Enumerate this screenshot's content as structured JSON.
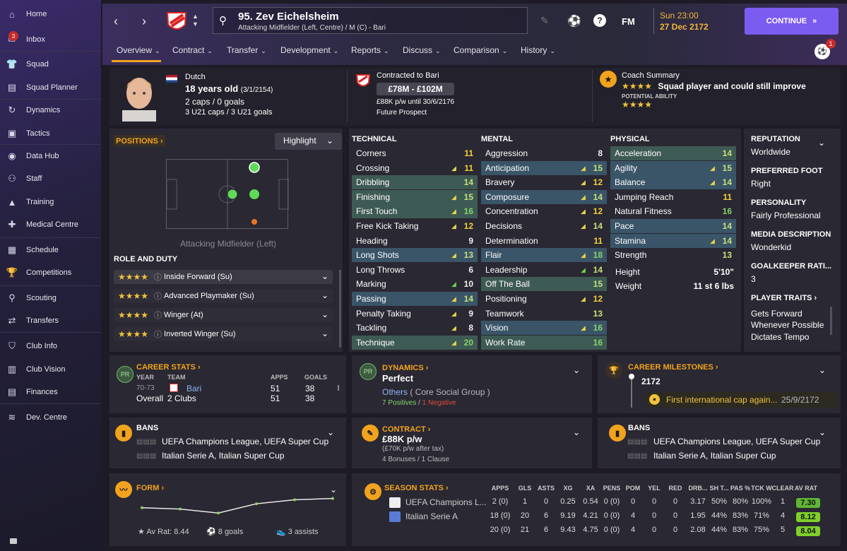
{
  "sidebar": {
    "items": [
      {
        "label": "Home",
        "icon": "home-icon"
      },
      {
        "label": "Inbox",
        "icon": "inbox-icon",
        "badge": "3"
      },
      {
        "label": "Squad",
        "icon": "squad-icon"
      },
      {
        "label": "Squad Planner",
        "icon": "planner-icon"
      },
      {
        "label": "Dynamics",
        "icon": "dynamics-icon"
      },
      {
        "label": "Tactics",
        "icon": "tactics-icon"
      },
      {
        "label": "Data Hub",
        "icon": "data-hub-icon"
      },
      {
        "label": "Staff",
        "icon": "staff-icon"
      },
      {
        "label": "Training",
        "icon": "training-icon"
      },
      {
        "label": "Medical Centre",
        "icon": "medical-icon"
      },
      {
        "label": "Schedule",
        "icon": "schedule-icon"
      },
      {
        "label": "Competitions",
        "icon": "trophy-icon"
      },
      {
        "label": "Scouting",
        "icon": "scouting-icon"
      },
      {
        "label": "Transfers",
        "icon": "transfers-icon"
      },
      {
        "label": "Club Info",
        "icon": "shield-icon"
      },
      {
        "label": "Club Vision",
        "icon": "vision-icon"
      },
      {
        "label": "Finances",
        "icon": "finances-icon"
      },
      {
        "label": "Dev. Centre",
        "icon": "dev-icon"
      }
    ]
  },
  "header": {
    "title": "95. Zev Eichelsheim",
    "subtitle": "Attacking Midfielder (Left, Centre) / M (C) - Bari",
    "date_line1": "Sun 23:00",
    "date_line2": "27 Dec 2172",
    "fm_label": "FM",
    "continue_label": "CONTINUE",
    "notif_count": "1"
  },
  "tabs": [
    "Overview",
    "Contract",
    "Transfer",
    "Development",
    "Reports",
    "Discuss",
    "Comparison",
    "History"
  ],
  "bio": {
    "nationality": "Dutch",
    "age": "18 years old",
    "dob": "(3/1/2154)",
    "caps": "2 caps / 0 goals",
    "u21": "3 U21 caps / 3 U21 goals"
  },
  "contract_box": {
    "label": "Contracted to Bari",
    "value_range": "£78M - £102M",
    "wage": "£88K p/w until 30/6/2176",
    "status": "Future Prospect"
  },
  "coach": {
    "label": "Coach Summary",
    "stars": "★★★★",
    "summary": "Squad player and could still improve",
    "potential_label": "POTENTIAL ABILITY",
    "potential_stars": "★★★★"
  },
  "positions": {
    "title": "POSITIONS",
    "highlight": "Highlight",
    "caption": "Attacking Midfielder (Left)"
  },
  "roles": {
    "title": "ROLE AND DUTY",
    "items": [
      {
        "stars": "★★★★",
        "name": "Inside Forward (Su)"
      },
      {
        "stars": "★★★★",
        "name": "Advanced Playmaker (Su)"
      },
      {
        "stars": "★★★★",
        "name": "Winger (At)"
      },
      {
        "stars": "★★★★",
        "name": "Inverted Winger (Su)"
      }
    ]
  },
  "technical": {
    "title": "TECHNICAL",
    "rows": [
      [
        "Corners",
        "11"
      ],
      [
        "Crossing",
        "11"
      ],
      [
        "Dribbling",
        "14"
      ],
      [
        "Finishing",
        "15"
      ],
      [
        "First Touch",
        "16"
      ],
      [
        "Free Kick Taking",
        "12"
      ],
      [
        "Heading",
        "9"
      ],
      [
        "Long Shots",
        "13"
      ],
      [
        "Long Throws",
        "6"
      ],
      [
        "Marking",
        "10"
      ],
      [
        "Passing",
        "14"
      ],
      [
        "Penalty Taking",
        "9"
      ],
      [
        "Tackling",
        "8"
      ],
      [
        "Technique",
        "20"
      ]
    ]
  },
  "mental": {
    "title": "MENTAL",
    "rows": [
      [
        "Aggression",
        "8"
      ],
      [
        "Anticipation",
        "15"
      ],
      [
        "Bravery",
        "12"
      ],
      [
        "Composure",
        "14"
      ],
      [
        "Concentration",
        "12"
      ],
      [
        "Decisions",
        "14"
      ],
      [
        "Determination",
        "11"
      ],
      [
        "Flair",
        "18"
      ],
      [
        "Leadership",
        "14"
      ],
      [
        "Off The Ball",
        "15"
      ],
      [
        "Positioning",
        "12"
      ],
      [
        "Teamwork",
        "13"
      ],
      [
        "Vision",
        "16"
      ],
      [
        "Work Rate",
        "16"
      ]
    ]
  },
  "physical": {
    "title": "PHYSICAL",
    "rows": [
      [
        "Acceleration",
        "14"
      ],
      [
        "Agility",
        "15"
      ],
      [
        "Balance",
        "14"
      ],
      [
        "Jumping Reach",
        "11"
      ],
      [
        "Natural Fitness",
        "16"
      ],
      [
        "Pace",
        "14"
      ],
      [
        "Stamina",
        "14"
      ],
      [
        "Strength",
        "13"
      ]
    ],
    "height_label": "Height",
    "height": "5'10\"",
    "weight_label": "Weight",
    "weight": "11 st 6 lbs"
  },
  "info": {
    "rep_label": "REPUTATION",
    "rep": "Worldwide",
    "foot_label": "PREFERRED FOOT",
    "foot": "Right",
    "pers_label": "PERSONALITY",
    "pers": "Fairly Professional",
    "media_label": "MEDIA DESCRIPTION",
    "media": "Wonderkid",
    "gk_label": "GOALKEEPER RATI...",
    "gk": "3",
    "traits_label": "PLAYER TRAITS",
    "traits": [
      "Gets Forward Whenever Possible",
      "Dictates Tempo"
    ]
  },
  "career": {
    "title": "CAREER STATS",
    "badge": "PR",
    "col_year": "YEAR",
    "col_team": "TEAM",
    "col_apps": "APPS",
    "col_goals": "GOALS",
    "row1": {
      "year": "70-73",
      "team": "Bari",
      "apps": "51",
      "goals": "38"
    },
    "row2": {
      "year": "Overall",
      "team": "2 Clubs",
      "apps": "51",
      "goals": "38"
    }
  },
  "dynamics": {
    "title": "DYNAMICS",
    "badge": "PR",
    "status": "Perfect",
    "group": "Others",
    "group_suffix": "( Core Social Group )",
    "positives": "7 Positives",
    "negatives": "1 Negative",
    "sep": "/"
  },
  "milestones": {
    "title": "CAREER MILESTONES",
    "year": "2172",
    "text": "First international cap again...",
    "date": "25/9/2172"
  },
  "bans_left": {
    "title": "BANS",
    "line1": "UEFA Champions League, UEFA Super Cup",
    "line2": "Italian Serie A, Italian Super Cup"
  },
  "contract_card": {
    "title": "CONTRACT",
    "wage": "£88K p/w",
    "after_tax": "(£70K p/w after tax)",
    "extras": "4 Bonuses / 1 Clause"
  },
  "bans_right": {
    "title": "BANS",
    "line1": "UEFA Champions League, UEFA Super Cup",
    "line2": "Italian Serie A, Italian Super Cup"
  },
  "form": {
    "title": "FORM",
    "avg": "Av Rat: 8.44",
    "goals": "8 goals",
    "assists": "3 assists",
    "values": [
      7.3,
      7.25,
      7.1,
      7.45,
      7.6,
      7.65
    ]
  },
  "season": {
    "title": "SEASON STATS",
    "cols": [
      "APPS",
      "GLS",
      "ASTS",
      "XG",
      "XA",
      "PENS",
      "POM",
      "YEL",
      "RED",
      "DRB...",
      "SH T...",
      "PAS %",
      "TCK W",
      "CLEAR",
      "AV RAT"
    ],
    "rows": [
      {
        "comp": "UEFA Champions L...",
        "icon": "ucl-icon",
        "vals": [
          "2 (0)",
          "1",
          "0",
          "0.25",
          "0.54",
          "0 (0)",
          "0",
          "0",
          "0",
          "3.17",
          "50%",
          "80%",
          "100%",
          "1"
        ],
        "rat": "7.30",
        "color": "#5fb535"
      },
      {
        "comp": "Italian Serie A",
        "icon": "serie-a-icon",
        "vals": [
          "18 (0)",
          "20",
          "6",
          "9.19",
          "4.21",
          "0 (0)",
          "4",
          "0",
          "0",
          "1.95",
          "44%",
          "83%",
          "71%",
          "4"
        ],
        "rat": "8.12",
        "color": "#7fcf2a"
      },
      {
        "comp": "",
        "icon": "",
        "vals": [
          "20 (0)",
          "21",
          "6",
          "9.43",
          "4.75",
          "0 (0)",
          "4",
          "0",
          "0",
          "2.08",
          "44%",
          "83%",
          "75%",
          "5"
        ],
        "rat": "8.04",
        "color": "#7fcf2a"
      }
    ]
  }
}
